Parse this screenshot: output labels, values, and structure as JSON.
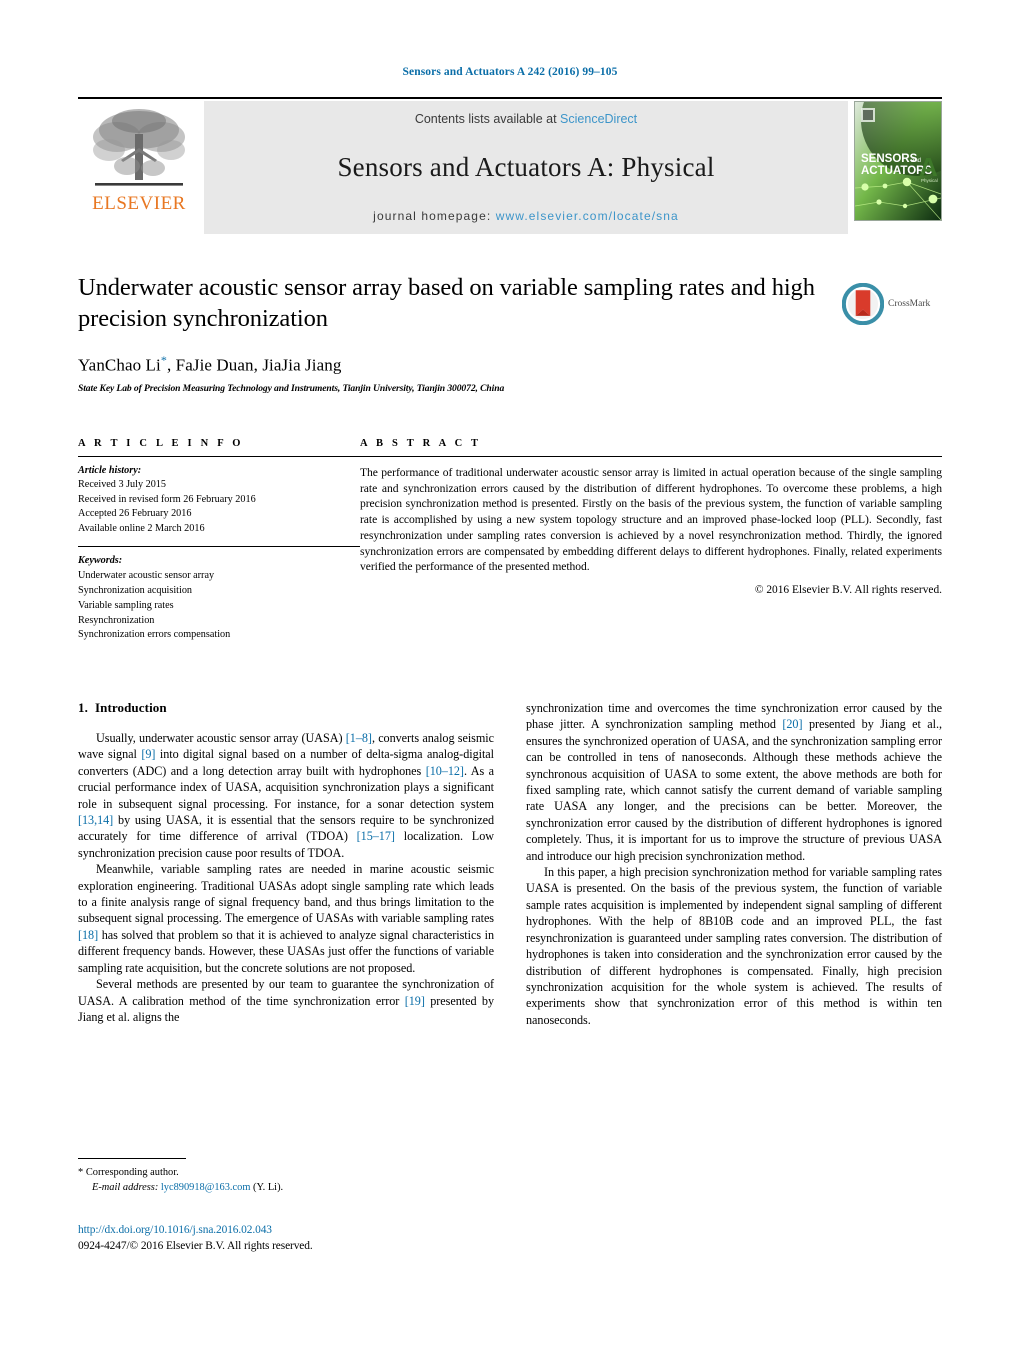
{
  "running_head": "Sensors and Actuators A 242 (2016) 99–105",
  "masthead": {
    "publisher_logo_text": "ELSEVIER",
    "contents_prefix": "Contents lists available at",
    "contents_link": "ScienceDirect",
    "journal_title": "Sensors and Actuators A: Physical",
    "homepage_prefix": "journal homepage:",
    "homepage_link": "www.elsevier.com/locate/sna",
    "cover": {
      "line1": "SENSORS",
      "line1_suffix": "and",
      "line2": "ACTUATORS",
      "letter": "A",
      "sub": "Physical"
    },
    "link_color": "#3d95c9",
    "band_color": "#e8e8e8",
    "elsevier_orange": "#E87722"
  },
  "title_block": {
    "title": "Underwater acoustic sensor array based on variable sampling rates and high precision synchronization",
    "authors": "YanChao Li",
    "author_marker": "*",
    "authors_rest": ", FaJie Duan, JiaJia Jiang",
    "affiliation": "State Key Lab of Precision Measuring Technology and Instruments, Tianjin University, Tianjin 300072, China",
    "crossmark_label": "CrossMark"
  },
  "article_info": {
    "heading": "A R T I C L E   I N F O",
    "history_label": "Article history:",
    "history": [
      "Received 3 July 2015",
      "Received in revised form 26 February 2016",
      "Accepted 26 February 2016",
      "Available online 2 March 2016"
    ],
    "keywords_label": "Keywords:",
    "keywords": [
      "Underwater acoustic sensor array",
      "Synchronization acquisition",
      "Variable sampling rates",
      "Resynchronization",
      "Synchronization errors compensation"
    ]
  },
  "abstract": {
    "heading": "A B S T R A C T",
    "text": "The performance of traditional underwater acoustic sensor array is limited in actual operation because of the single sampling rate and synchronization errors caused by the distribution of different hydrophones. To overcome these problems, a high precision synchronization method is presented. Firstly on the basis of the previous system, the function of variable sampling rate is accomplished by using a new system topology structure and an improved phase-locked loop (PLL). Secondly, fast resynchronization under sampling rates conversion is achieved by a novel resynchronization method. Thirdly, the ignored synchronization errors are compensated by embedding different delays to different hydrophones. Finally, related experiments verified the performance of the presented method.",
    "copyright": "© 2016 Elsevier B.V. All rights reserved."
  },
  "body": {
    "section_number": "1.",
    "section_title": "Introduction",
    "left_paragraphs": [
      {
        "parts": [
          {
            "t": "Usually, underwater acoustic sensor array (UASA) ",
            "c": false
          },
          {
            "t": "[1–8]",
            "c": true
          },
          {
            "t": ", converts analog seismic wave signal ",
            "c": false
          },
          {
            "t": "[9]",
            "c": true
          },
          {
            "t": " into digital signal based on a number of delta-sigma analog-digital converters (ADC) and a long detection array built with hydrophones ",
            "c": false
          },
          {
            "t": "[10–12]",
            "c": true
          },
          {
            "t": ". As a crucial performance index of UASA, acquisition synchronization plays a significant role in subsequent signal processing. For instance, for a sonar detection system ",
            "c": false
          },
          {
            "t": "[13,14]",
            "c": true
          },
          {
            "t": " by using UASA, it is essential that the sensors require to be synchronized accurately for time difference of arrival (TDOA) ",
            "c": false
          },
          {
            "t": "[15–17]",
            "c": true
          },
          {
            "t": " localization. Low synchronization precision cause poor results of TDOA.",
            "c": false
          }
        ]
      },
      {
        "parts": [
          {
            "t": "Meanwhile, variable sampling rates are needed in marine acoustic seismic exploration engineering. Traditional UASAs adopt single sampling rate which leads to a finite analysis range of signal frequency band, and thus brings limitation to the subsequent signal processing. The emergence of UASAs with variable sampling rates ",
            "c": false
          },
          {
            "t": "[18]",
            "c": true
          },
          {
            "t": " has solved that problem so that it is achieved to analyze signal characteristics in different frequency bands. However, these UASAs just offer the functions of variable sampling rate acquisition, but the concrete solutions are not proposed.",
            "c": false
          }
        ]
      },
      {
        "parts": [
          {
            "t": "Several methods are presented by our team to guarantee the synchronization of UASA. A calibration method of the time synchronization error ",
            "c": false
          },
          {
            "t": "[19]",
            "c": true
          },
          {
            "t": " presented by Jiang et al. aligns the",
            "c": false
          }
        ]
      }
    ],
    "right_paragraphs": [
      {
        "parts": [
          {
            "t": "synchronization time and overcomes the time synchronization error caused by the phase jitter. A synchronization sampling method ",
            "c": false
          },
          {
            "t": "[20]",
            "c": true
          },
          {
            "t": " presented by Jiang et al., ensures the synchronized operation of UASA, and the synchronization sampling error can be controlled in tens of nanoseconds. Although these methods achieve the synchronous acquisition of UASA to some extent, the above methods are both for fixed sampling rate, which cannot satisfy the current demand of variable sampling rate UASA any longer, and the precisions can be better. Moreover, the synchronization error caused by the distribution of different hydrophones is ignored completely. Thus, it is important for us to improve the structure of previous UASA and introduce our high precision synchronization method.",
            "c": false
          }
        ]
      },
      {
        "parts": [
          {
            "t": "In this paper, a high precision synchronization method for variable sampling rates UASA is presented. On the basis of the previous system, the function of variable sample rates acquisition is implemented by independent signal sampling of different hydrophones. With the help of 8B10B code and an improved PLL, the fast resynchronization is guaranteed under sampling rates conversion. The distribution of hydrophones is taken into consideration and the synchronization error caused by the distribution of different hydrophones is compensated. Finally, high precision synchronization acquisition for the whole system is achieved. The results of experiments show that synchronization error of this method is within ten nanoseconds.",
            "c": false
          }
        ]
      }
    ]
  },
  "footnote": {
    "corresponding_marker": "*",
    "corresponding_text": "Corresponding author.",
    "email_label": "E-mail address:",
    "email": "lyc890918@163.com",
    "email_suffix": "(Y. Li).",
    "doi": "http://dx.doi.org/10.1016/j.sna.2016.02.043",
    "issn_copyright": "0924-4247/© 2016 Elsevier B.V. All rights reserved."
  },
  "colors": {
    "link_blue": "#0b6ea8",
    "cite_blue": "#0b6ea8",
    "elsevier_orange": "#E87722"
  }
}
